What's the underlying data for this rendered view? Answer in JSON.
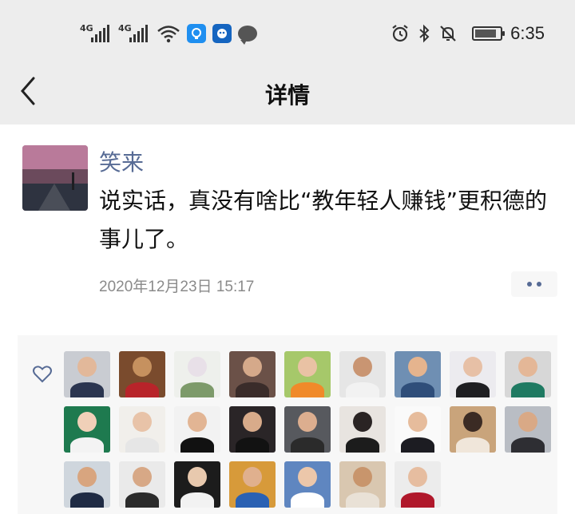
{
  "status_bar": {
    "net1": "4G",
    "net2": "4G",
    "time": "6:35",
    "battery_level": 0.85
  },
  "nav": {
    "title": "详情",
    "back_icon": "chevron-left-icon"
  },
  "post": {
    "author": "笑来",
    "content": "说实话，真没有啥比“教年轻人赚钱”更积德的事儿了。",
    "timestamp": "2020年12月23日 15:17",
    "more_icon": "more-dots-icon"
  },
  "likes": {
    "icon": "heart-outline-icon",
    "accent": "#576b95",
    "avatars": [
      {
        "bg": "#c9ccd2",
        "head": "#e2b89a",
        "body": "#2b3550"
      },
      {
        "bg": "#7a4b2d",
        "head": "#c6915f",
        "body": "#b8242a"
      },
      {
        "bg": "#eef0ec",
        "head": "#e8e0e8",
        "body": "#7d9a6a"
      },
      {
        "bg": "#6b5148",
        "head": "#d5a98a",
        "body": "#3a2c2a"
      },
      {
        "bg": "#a6c86a",
        "head": "#e9c2a4",
        "body": "#f08a2a"
      },
      {
        "bg": "#e6e6e6",
        "head": "#c99572",
        "body": "#f2f2f2"
      },
      {
        "bg": "#6f8fb3",
        "head": "#e5b48e",
        "body": "#2f4e7a"
      },
      {
        "bg": "#ecebef",
        "head": "#e7c0a6",
        "body": "#1f1f22"
      },
      {
        "bg": "#d7d7d7",
        "head": "#e4b797",
        "body": "#1f7a62"
      },
      {
        "bg": "#1e7a4f",
        "head": "#f0d0b8",
        "body": "#f3f3f3"
      },
      {
        "bg": "#f1efeb",
        "head": "#e8c3a8",
        "body": "#e6e6e6"
      },
      {
        "bg": "#f2f2f2",
        "head": "#e2b594",
        "body": "#111111"
      },
      {
        "bg": "#2a2527",
        "head": "#d8ab8a",
        "body": "#121212"
      },
      {
        "bg": "#57595e",
        "head": "#dcae8f",
        "body": "#2b2b2b"
      },
      {
        "bg": "#e8e4e0",
        "head": "#2a2424",
        "body": "#1c1c1c"
      },
      {
        "bg": "#fafafa",
        "head": "#e6bc9c",
        "body": "#1c1c22"
      },
      {
        "bg": "#c9a47b",
        "head": "#3b2b24",
        "body": "#f0e6da"
      },
      {
        "bg": "#b9bdc4",
        "head": "#d9a986",
        "body": "#2e2e33"
      },
      {
        "bg": "#cfd6dd",
        "head": "#d8a57f",
        "body": "#1f2b44"
      },
      {
        "bg": "#eaeaea",
        "head": "#d7a886",
        "body": "#2b2b2b"
      },
      {
        "bg": "#1c1c1c",
        "head": "#e8c9ae",
        "body": "#f2f2f2"
      },
      {
        "bg": "#d79a3a",
        "head": "#e0b08e",
        "body": "#2a61b3"
      },
      {
        "bg": "#5f86c0",
        "head": "#ecc7aa",
        "body": "#ffffff"
      },
      {
        "bg": "#d9c7b0",
        "head": "#c8956c",
        "body": "#e9e1d6"
      },
      {
        "bg": "#ececec",
        "head": "#e6bda0",
        "body": "#b0182b"
      }
    ]
  }
}
